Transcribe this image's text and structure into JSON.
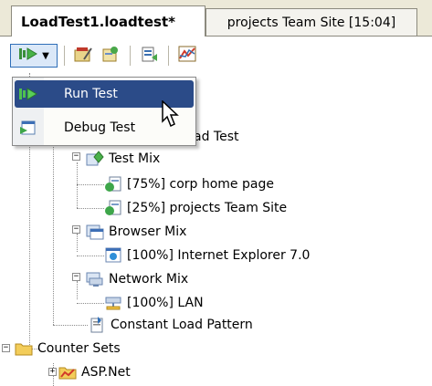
{
  "tabs": [
    {
      "label": "LoadTest1.loadtest*",
      "active": true
    },
    {
      "label": "projects Team Site [15:04]",
      "active": false
    }
  ],
  "toolbar": {
    "icons": [
      "run-test-icon",
      "edit-settings-icon",
      "add-scenario-icon",
      "manage-icon",
      "chart-icon"
    ]
  },
  "menu": {
    "items": [
      {
        "label": "Run Test",
        "icon": "run-test-icon",
        "highlighted": true
      },
      {
        "label": "Debug Test",
        "icon": "debug-test-icon",
        "highlighted": false
      }
    ]
  },
  "tree": {
    "partial_label": "ad Test",
    "test_mix": "Test Mix",
    "tests": [
      "[75%] corp home page",
      "[25%] projects Team Site"
    ],
    "browser_mix": "Browser Mix",
    "browsers": [
      "[100%] Internet Explorer 7.0"
    ],
    "network_mix": "Network Mix",
    "networks": [
      "[100%] LAN"
    ],
    "load_pattern": "Constant Load Pattern",
    "counter_sets": "Counter Sets",
    "counter_items": [
      "ASP.Net"
    ]
  },
  "colors": {
    "menu_highlight": "#2b4b88",
    "tab_strip": "#ece9d8",
    "toolbar_button_border": "#2f6fb8"
  }
}
